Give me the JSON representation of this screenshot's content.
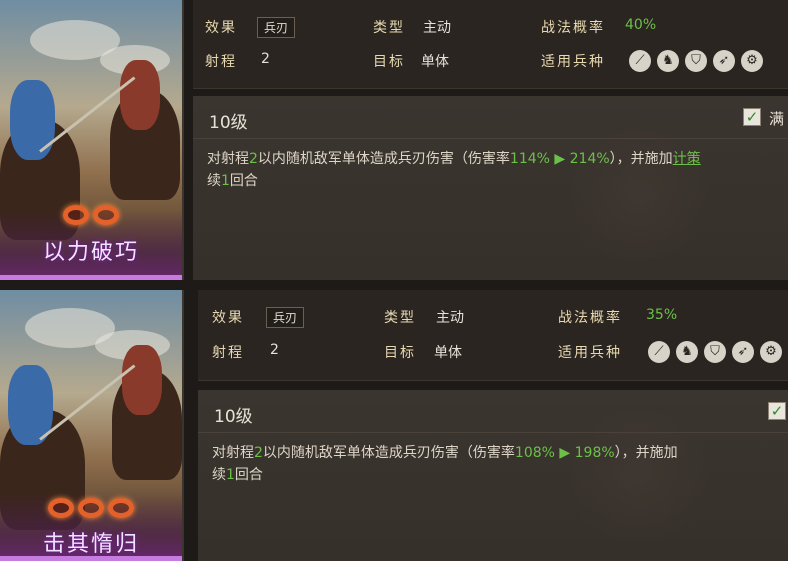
{
  "cards": [
    {
      "tactic_name": "以力破巧",
      "effect_label": "效果",
      "effect_value": "兵刃",
      "type_label": "类型",
      "type_value": "主动",
      "rate_label": "战法概率",
      "rate_value": "40%",
      "range_label": "射程",
      "range_value": "2",
      "target_label": "目标",
      "target_value": "单体",
      "troops_label": "适用兵种",
      "troop_icons": [
        "spear-icon",
        "cavalry-icon",
        "shield-icon",
        "bow-icon",
        "siege-icon"
      ],
      "level": "10级",
      "max_label": "满",
      "desc_line1_a": "对射程",
      "desc_line1_b": "2",
      "desc_line1_c": "以内随机敌军单体造成兵刃伤害（伤害率",
      "desc_line1_d": "114%",
      "desc_line1_e": "214%",
      "desc_line1_f": "），并施加",
      "desc_line1_link": "计策",
      "desc_line2_a": "续",
      "desc_line2_b": "1",
      "desc_line2_c": "回合"
    },
    {
      "tactic_name": "击其惰归",
      "effect_label": "效果",
      "effect_value": "兵刃",
      "type_label": "类型",
      "type_value": "主动",
      "rate_label": "战法概率",
      "rate_value": "35%",
      "range_label": "射程",
      "range_value": "2",
      "target_label": "目标",
      "target_value": "单体",
      "troops_label": "适用兵种",
      "troop_icons": [
        "spear-icon",
        "cavalry-icon",
        "shield-icon",
        "bow-icon",
        "siege-icon"
      ],
      "level": "10级",
      "desc_line1_a": "对射程",
      "desc_line1_b": "2",
      "desc_line1_c": "以内随机敌军单体造成兵刃伤害（伤害率",
      "desc_line1_d": "108%",
      "desc_line1_e": "198%",
      "desc_line1_f": "），并施加",
      "desc_line2_a": "续",
      "desc_line2_b": "1",
      "desc_line2_c": "回合"
    }
  ],
  "colors": {
    "accent_green": "#6cc04a",
    "label_gold": "#e8d9b0",
    "panel": "#2a2520"
  }
}
